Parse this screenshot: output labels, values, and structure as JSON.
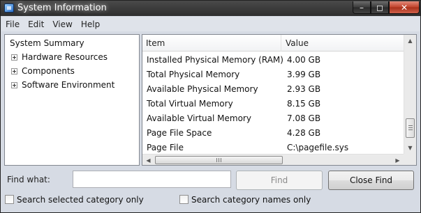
{
  "window": {
    "title": "System Information"
  },
  "menu": [
    "File",
    "Edit",
    "View",
    "Help"
  ],
  "tree": {
    "root": "System Summary",
    "children": [
      "Hardware Resources",
      "Components",
      "Software Environment"
    ]
  },
  "list": {
    "columns": [
      "Item",
      "Value"
    ],
    "rows": [
      [
        "Installed Physical Memory (RAM)",
        "4.00 GB"
      ],
      [
        "Total Physical Memory",
        "3.99 GB"
      ],
      [
        "Available Physical Memory",
        "2.93 GB"
      ],
      [
        "Total Virtual Memory",
        "8.15 GB"
      ],
      [
        "Available Virtual Memory",
        "7.08 GB"
      ],
      [
        "Page File Space",
        "4.28 GB"
      ],
      [
        "Page File",
        "C:\\pagefile.sys"
      ]
    ]
  },
  "find": {
    "label": "Find what:",
    "value": "",
    "find_button": "Find",
    "close_button": "Close Find",
    "option_selected_category": "Search selected category only",
    "option_category_names": "Search category names only"
  },
  "colors": {
    "titlebar": "#2e2e2e",
    "close_button": "#c1412a",
    "window_bg": "#d6dbe4"
  }
}
